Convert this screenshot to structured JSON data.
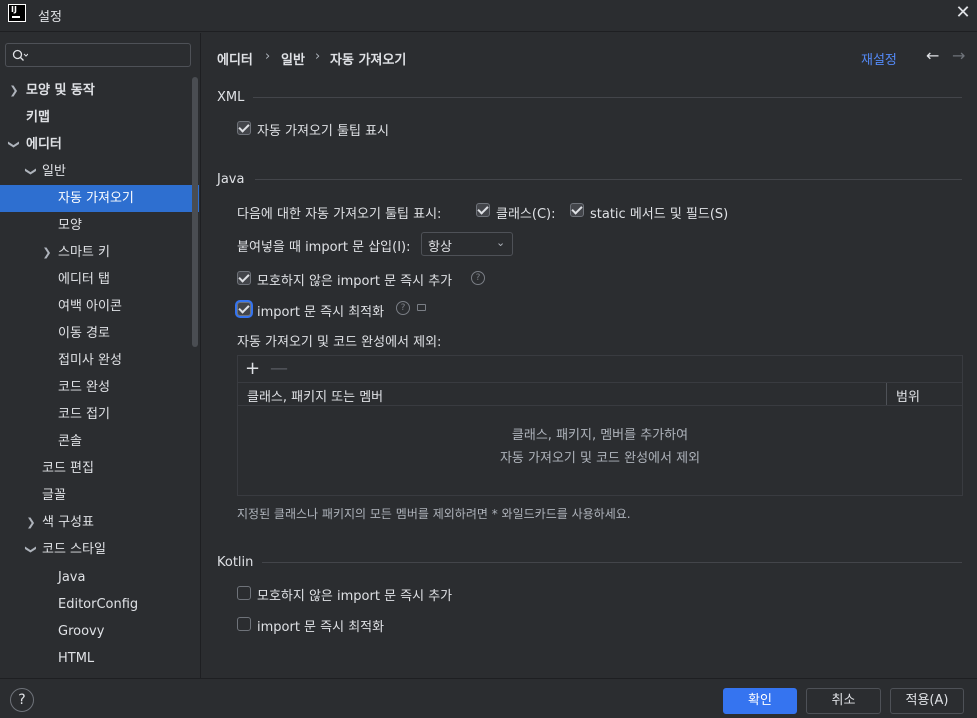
{
  "window": {
    "title": "설정",
    "logo": "IJ"
  },
  "search": {
    "placeholder": ""
  },
  "sidebar": {
    "items": [
      {
        "label": "모양 및 동작"
      },
      {
        "label": "키맵"
      },
      {
        "label": "에디터"
      },
      {
        "label": "일반"
      },
      {
        "label": "자동 가져오기"
      },
      {
        "label": "모양"
      },
      {
        "label": "스마트 키"
      },
      {
        "label": "에디터 탭"
      },
      {
        "label": "여백 아이콘"
      },
      {
        "label": "이동 경로"
      },
      {
        "label": "접미사 완성"
      },
      {
        "label": "코드 완성"
      },
      {
        "label": "코드 접기"
      },
      {
        "label": "콘솔"
      },
      {
        "label": "코드 편집"
      },
      {
        "label": "글꼴"
      },
      {
        "label": "색 구성표"
      },
      {
        "label": "코드 스타일"
      },
      {
        "label": "Java"
      },
      {
        "label": "EditorConfig"
      },
      {
        "label": "Groovy"
      },
      {
        "label": "HTML"
      }
    ]
  },
  "breadcrumb": {
    "part1": "에디터",
    "part2": "일반",
    "part3": "자동 가져오기",
    "sep": "›"
  },
  "header": {
    "reset": "재설정",
    "back": "←",
    "forward": "→"
  },
  "xml": {
    "title": "XML",
    "show_tooltip": {
      "label": "자동 가져오기 툴팁 표시",
      "checked": true
    }
  },
  "java": {
    "title": "Java",
    "tooltip_for_label": "다음에 대한 자동 가져오기 툴팁 표시:",
    "classes": {
      "label": "클래스(C):",
      "checked": true
    },
    "static_members": {
      "label": "static 메서드 및 필드(S)",
      "checked": true
    },
    "insert_on_paste_label": "붙여넣을 때 import 문 삽입(I):",
    "insert_on_paste_value": "항상",
    "add_unambiguous": {
      "label": "모호하지 않은 import 문 즉시 추가",
      "checked": true
    },
    "optimize_on_fly": {
      "label": "import 문 즉시 최적화",
      "checked": true
    },
    "exclude_label": "자동 가져오기 및 코드 완성에서 제외:",
    "table": {
      "add": "+",
      "remove": "—",
      "col_member": "클래스, 패키지 또는 멤버",
      "col_scope": "범위",
      "empty_line1": "클래스, 패키지, 멤버를 추가하여",
      "empty_line2": "자동 가져오기 및 코드 완성에서 제외"
    },
    "hint": "지정된 클래스나 패키지의 모든 멤버를 제외하려면 * 와일드카드를 사용하세요."
  },
  "kotlin": {
    "title": "Kotlin",
    "add_unambiguous": {
      "label": "모호하지 않은 import 문 즉시 추가",
      "checked": false
    },
    "optimize_on_fly": {
      "label": "import 문 즉시 최적화",
      "checked": false
    }
  },
  "footer": {
    "help": "?",
    "ok": "확인",
    "cancel": "취소",
    "apply": "적용(A)"
  },
  "colors": {
    "accent": "#3574f0",
    "selection": "#2e6fd0",
    "link": "#548af7",
    "background": "#2b2d30"
  }
}
